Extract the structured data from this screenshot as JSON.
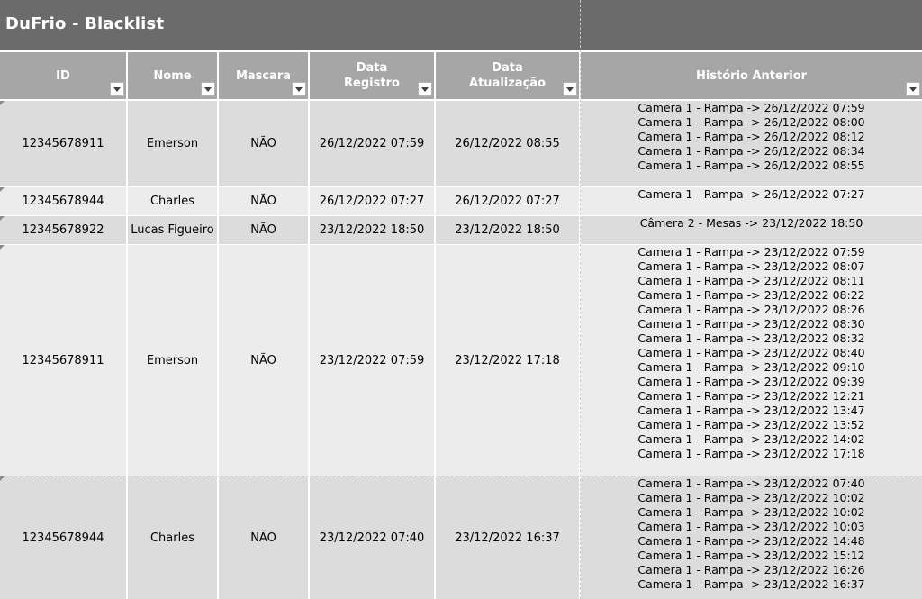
{
  "sheet": {
    "title": "DuFrio - Blacklist"
  },
  "columns": [
    {
      "key": "id",
      "label": "ID"
    },
    {
      "key": "nome",
      "label": "Nome"
    },
    {
      "key": "mascara",
      "label": "Mascara"
    },
    {
      "key": "data_registro",
      "label": "Data Registro"
    },
    {
      "key": "data_atualizacao",
      "label": "Data Atualização"
    },
    {
      "key": "historico",
      "label": "Histório Anterior"
    }
  ],
  "rows": [
    {
      "id": "12345678911",
      "nome": "Emerson",
      "mascara": "NÃO",
      "data_registro": "26/12/2022 07:59",
      "data_atualizacao": "26/12/2022 08:55",
      "historico": [
        "Camera 1 - Rampa -> 26/12/2022 07:59",
        "Camera 1 - Rampa -> 26/12/2022 08:00",
        "Camera 1 - Rampa -> 26/12/2022 08:12",
        "Camera 1 - Rampa -> 26/12/2022 08:34",
        "Camera 1 - Rampa -> 26/12/2022 08:55"
      ]
    },
    {
      "id": "12345678944",
      "nome": "Charles",
      "mascara": "NÃO",
      "data_registro": "26/12/2022 07:27",
      "data_atualizacao": "26/12/2022 07:27",
      "historico": [
        "Camera 1 - Rampa -> 26/12/2022 07:27"
      ]
    },
    {
      "id": "12345678922",
      "nome": "Lucas Figueiro",
      "mascara": "NÃO",
      "data_registro": "23/12/2022 18:50",
      "data_atualizacao": "23/12/2022 18:50",
      "historico": [
        "Câmera 2 - Mesas -> 23/12/2022 18:50"
      ]
    },
    {
      "id": "12345678911",
      "nome": "Emerson",
      "mascara": "NÃO",
      "data_registro": "23/12/2022 07:59",
      "data_atualizacao": "23/12/2022 17:18",
      "historico": [
        "Camera 1 - Rampa -> 23/12/2022 07:59",
        "Camera 1 - Rampa -> 23/12/2022 08:07",
        "Camera 1 - Rampa -> 23/12/2022 08:11",
        "Camera 1 - Rampa -> 23/12/2022 08:22",
        "Camera 1 - Rampa -> 23/12/2022 08:26",
        "Camera 1 - Rampa -> 23/12/2022 08:30",
        "Camera 1 - Rampa -> 23/12/2022 08:32",
        "Camera 1 - Rampa -> 23/12/2022 08:40",
        "Camera 1 - Rampa -> 23/12/2022 09:10",
        "Camera 1 - Rampa -> 23/12/2022 09:39",
        "Camera 1 - Rampa -> 23/12/2022 12:21",
        "Camera 1 - Rampa -> 23/12/2022 13:47",
        "Camera 1 - Rampa -> 23/12/2022 13:52",
        "Camera 1 - Rampa -> 23/12/2022 14:02",
        "Camera 1 - Rampa -> 23/12/2022 17:18"
      ]
    },
    {
      "id": "12345678944",
      "nome": "Charles",
      "mascara": "NÃO",
      "data_registro": "23/12/2022 07:40",
      "data_atualizacao": "23/12/2022 16:37",
      "historico": [
        "Camera 1 - Rampa -> 23/12/2022 07:40",
        "Camera 1 - Rampa -> 23/12/2022 10:02",
        "Camera 1 - Rampa -> 23/12/2022 10:02",
        "Camera 1 - Rampa -> 23/12/2022 10:03",
        "Camera 1 - Rampa -> 23/12/2022 14:48",
        "Camera 1 - Rampa -> 23/12/2022 15:12",
        "Camera 1 - Rampa -> 23/12/2022 16:26",
        "Camera 1 - Rampa -> 23/12/2022 16:37"
      ]
    }
  ],
  "icons": {
    "filter": "dropdown-filter-icon",
    "row_marker": "comment-indicator-icon"
  },
  "colors": {
    "title_bg": "#6b6b6b",
    "header_bg": "#a6a6a6",
    "row_dark": "#dcdcdc",
    "row_light": "#ececec"
  }
}
